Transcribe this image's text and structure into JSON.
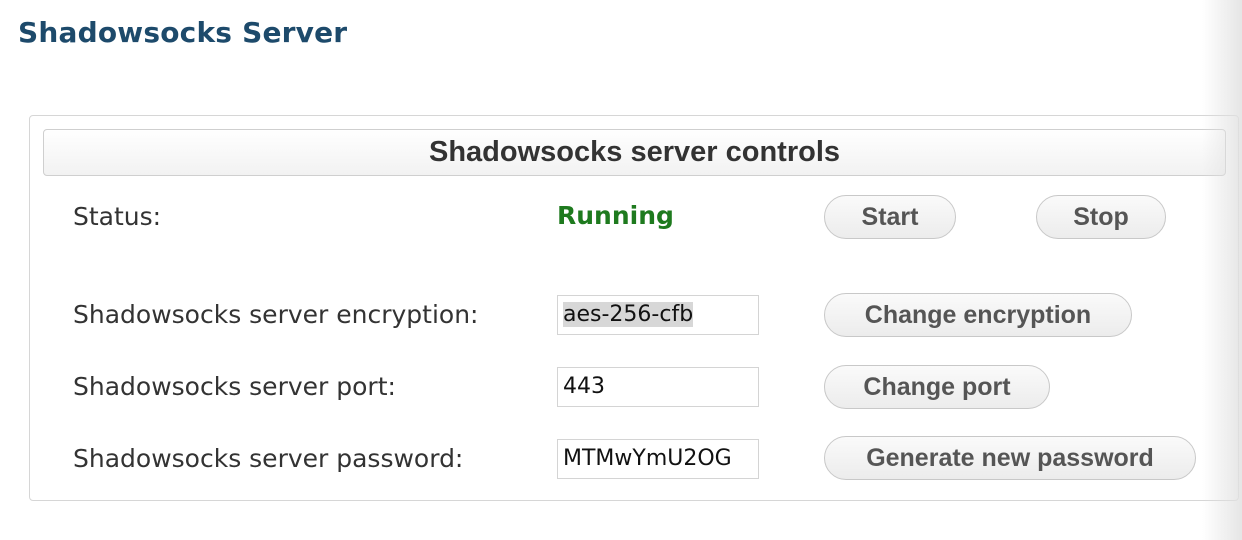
{
  "page": {
    "title": "Shadowsocks Server"
  },
  "panel": {
    "header": "Shadowsocks server controls",
    "status": {
      "label": "Status:",
      "value": "Running",
      "value_color": "#1e7a1e",
      "start_label": "Start",
      "stop_label": "Stop"
    },
    "encryption": {
      "label": "Shadowsocks server encryption:",
      "value": "aes-256-cfb",
      "value_selected": true,
      "button_label": "Change encryption"
    },
    "port": {
      "label": "Shadowsocks server port:",
      "value": "443",
      "button_label": "Change port"
    },
    "password": {
      "label": "Shadowsocks server password:",
      "value": "MTMwYmU2OG",
      "button_label": "Generate new password"
    }
  },
  "colors": {
    "title": "#1d4a6b",
    "text": "#333333",
    "button_text": "#555555"
  }
}
